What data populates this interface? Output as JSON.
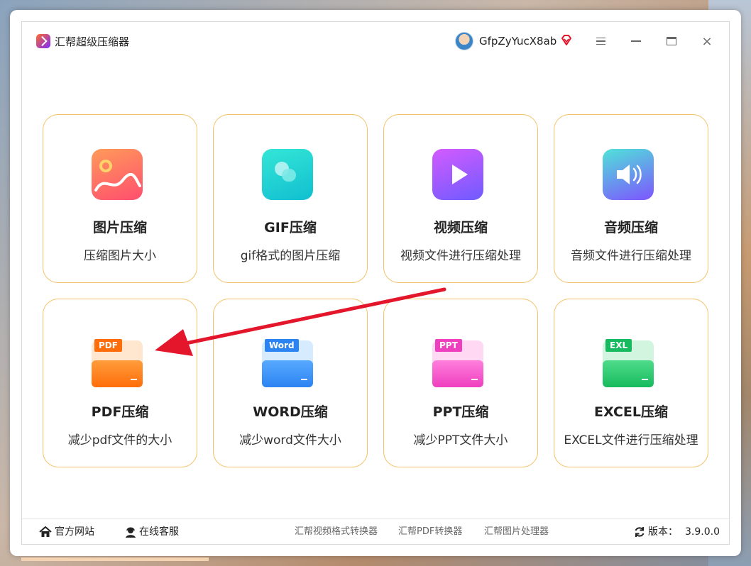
{
  "window": {
    "title": "汇帮超级压缩器",
    "username": "GfpZyYucX8ab",
    "close_glyph": "×"
  },
  "cards": [
    {
      "title": "图片压缩",
      "desc": "压缩图片大小",
      "icon": "image-icon"
    },
    {
      "title": "GIF压缩",
      "desc": "gif格式的图片压缩",
      "icon": "gif-icon"
    },
    {
      "title": "视频压缩",
      "desc": "视频文件进行压缩处理",
      "icon": "video-play-icon"
    },
    {
      "title": "音频压缩",
      "desc": "音频文件进行压缩处理",
      "icon": "audio-speaker-icon"
    },
    {
      "title": "PDF压缩",
      "desc": "减少pdf文件的大小",
      "icon": "pdf-folder-icon",
      "badge": "PDF"
    },
    {
      "title": "WORD压缩",
      "desc": "减少word文件大小",
      "icon": "word-folder-icon",
      "badge": "Word"
    },
    {
      "title": "PPT压缩",
      "desc": "减少PPT文件大小",
      "icon": "ppt-folder-icon",
      "badge": "PPT"
    },
    {
      "title": "EXCEL压缩",
      "desc": "EXCEL文件进行压缩处理",
      "icon": "excel-folder-icon",
      "badge": "EXL"
    }
  ],
  "footer": {
    "website": "官方网站",
    "support": "在线客服",
    "links": [
      "汇帮视频格式转换器",
      "汇帮PDF转换器",
      "汇帮图片处理器"
    ],
    "version_label": "版本：",
    "version": "3.9.0.0"
  },
  "colors": {
    "card_border": "#f4c06a",
    "annotation_arrow": "#e4162b",
    "pdf": "#ff7a1a",
    "word": "#2f8cf5",
    "ppt": "#f05cc8",
    "excel": "#21c46a"
  }
}
